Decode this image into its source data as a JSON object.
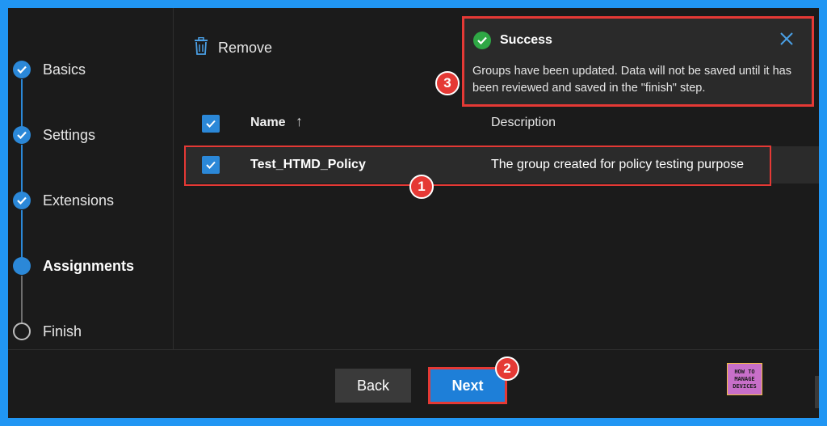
{
  "sidebar": {
    "steps": [
      {
        "label": "Basics",
        "state": "done"
      },
      {
        "label": "Settings",
        "state": "done"
      },
      {
        "label": "Extensions",
        "state": "done"
      },
      {
        "label": "Assignments",
        "state": "current"
      },
      {
        "label": "Finish",
        "state": "todo"
      }
    ]
  },
  "toolbar": {
    "remove_label": "Remove",
    "remove_icon": "trash-icon"
  },
  "table": {
    "columns": [
      {
        "label": "Name",
        "sort": "ascending"
      },
      {
        "label": "Description"
      }
    ],
    "select_all_checked": true,
    "rows": [
      {
        "name": "Test_HTMD_Policy",
        "description": "The group created for policy testing purpose",
        "checked": true
      }
    ]
  },
  "toast": {
    "title": "Success",
    "message": "Groups have been updated. Data will not be saved until it has been reviewed and saved in the \"finish\" step.",
    "status_icon": "checkmark-circle-icon",
    "close_icon": "close-icon"
  },
  "footer": {
    "back_label": "Back",
    "next_label": "Next"
  },
  "annotations": [
    "1",
    "2",
    "3"
  ],
  "logo": {
    "lines": [
      "HOW TO",
      "MANAGE",
      "DEVICES"
    ]
  },
  "colors": {
    "accent": "#2b88d8",
    "highlight": "#e53935",
    "success": "#2fa745",
    "border": "#2196f3"
  }
}
